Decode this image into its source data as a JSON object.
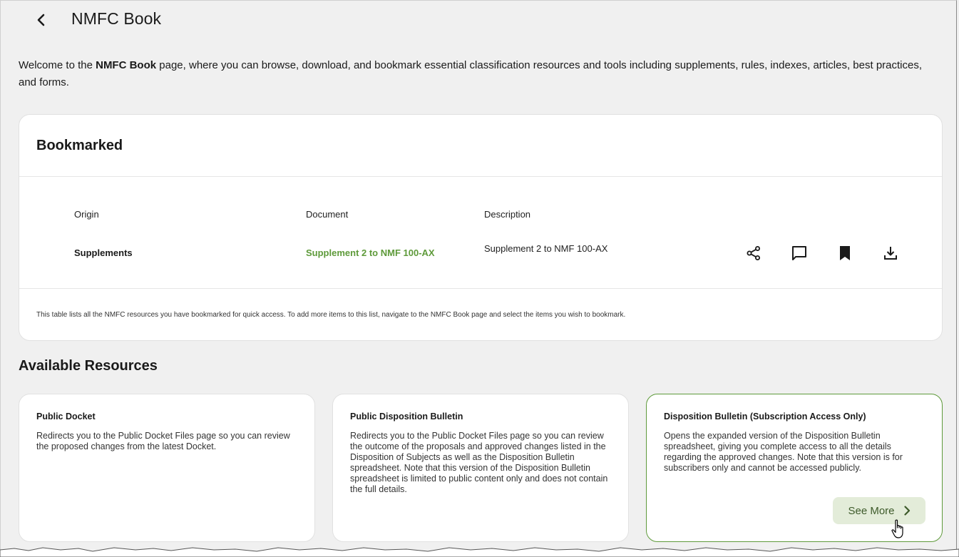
{
  "header": {
    "title": "NMFC Book",
    "back_icon": "chevron-left-icon"
  },
  "intro": {
    "prefix": "Welcome to the ",
    "bold": "NMFC Book",
    "suffix": " page, where you can browse, download, and bookmark essential classification resources and tools including supplements, rules, indexes, articles, best practices, and forms."
  },
  "bookmarked": {
    "title": "Bookmarked",
    "columns": [
      "Origin",
      "Document",
      "Description"
    ],
    "rows": [
      {
        "origin": "Supplements",
        "document": "Supplement 2 to NMF 100-AX",
        "description": "Supplement 2 to NMF 100-AX",
        "actions": [
          "share-icon",
          "comment-icon",
          "bookmark-icon",
          "download-icon"
        ]
      }
    ],
    "footnote": "This table lists all the NMFC resources you have bookmarked for quick access. To add more items to this list, navigate to the NMFC Book page and select the items you wish to bookmark."
  },
  "resources": {
    "title": "Available Resources",
    "cards": [
      {
        "title": "Public Docket",
        "description": "Redirects you to the Public Docket Files page so you can review the proposed changes from the latest Docket."
      },
      {
        "title": "Public Disposition Bulletin",
        "description": "Redirects you to the Public Docket Files page so you can review the outcome of the proposals and approved changes listed in the Disposition of Subjects as well as the Disposition Bulletin spreadsheet. Note that this version of the Disposition Bulletin spreadsheet is limited to public content only and does not contain the full details."
      },
      {
        "title": "Disposition Bulletin (Subscription Access Only)",
        "description": "Opens the expanded version of the Disposition Bulletin spreadsheet, giving you complete access to all the details regarding the approved changes. Note that this version is for subscribers only and cannot be accessed publicly.",
        "button": "See More"
      }
    ]
  },
  "colors": {
    "accent": "#5e9a3a",
    "button_bg": "#e3ecd9",
    "page_bg": "#f0f0f0"
  }
}
